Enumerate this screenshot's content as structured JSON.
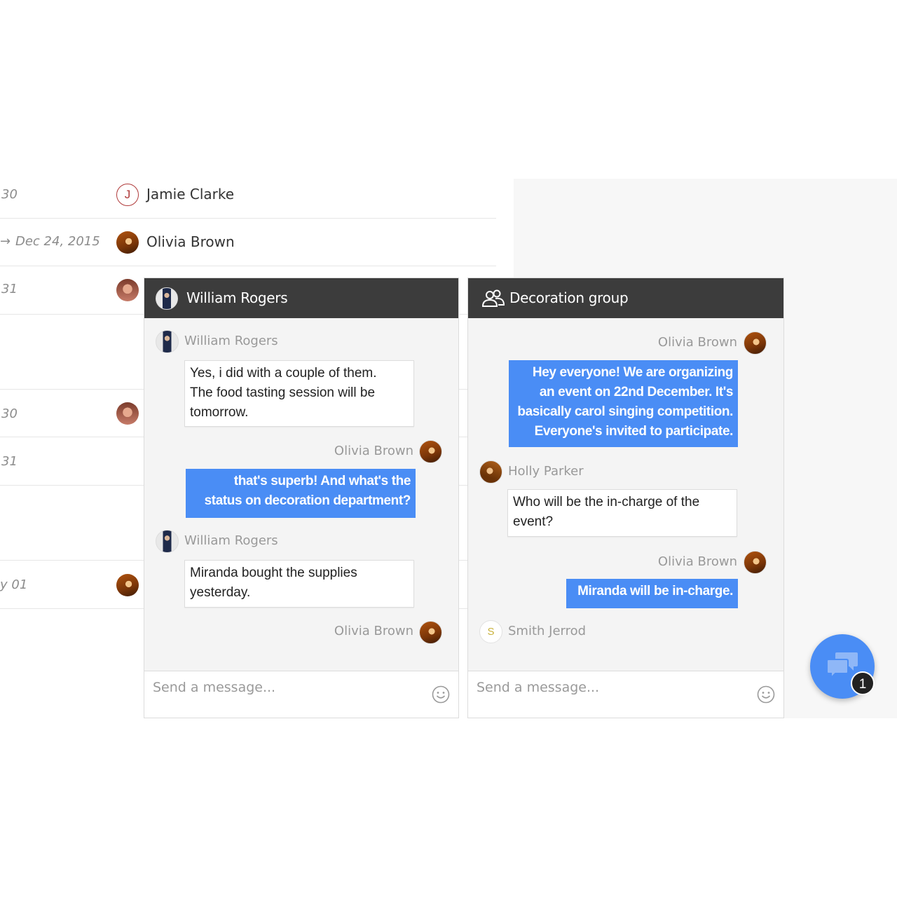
{
  "background_list": {
    "rows": [
      {
        "date": "30",
        "name": "Jamie Clarke",
        "initial": "J"
      },
      {
        "date": "Dec 24, 2015",
        "name": "Olivia Brown"
      },
      {
        "date": "31"
      },
      {
        "date": "30"
      },
      {
        "date": "31"
      },
      {
        "date": "y 01"
      }
    ]
  },
  "chat_william": {
    "title": "William Rogers",
    "messages": [
      {
        "sender": "William Rogers",
        "text_lines": [
          "Yes, i did with a couple of them.",
          "The food tasting session will be",
          "tomorrow."
        ]
      },
      {
        "sender": "Olivia Brown",
        "text_lines": [
          "that's superb! And what's the",
          "status on decoration department?"
        ]
      },
      {
        "sender": "William Rogers",
        "text_lines": [
          "Miranda bought the supplies",
          "yesterday."
        ]
      },
      {
        "sender": "Olivia Brown"
      }
    ],
    "composer_placeholder": "Send a message..."
  },
  "chat_group": {
    "title": "Decoration group",
    "messages": [
      {
        "sender": "Olivia Brown",
        "text_lines": [
          "Hey everyone! We are organizing",
          "an event on 22nd December. It's",
          "basically carol singing competition.",
          "Everyone's invited to participate."
        ]
      },
      {
        "sender": "Holly Parker",
        "text_lines": [
          "Who will be the in-charge of the",
          "event?"
        ]
      },
      {
        "sender": "Olivia Brown",
        "text_lines": [
          "Miranda will be in-charge."
        ]
      },
      {
        "sender": "Smith Jerrod",
        "initial": "S"
      }
    ],
    "composer_placeholder": "Send a message..."
  },
  "fab": {
    "icon": "chat-bubbles-icon",
    "badge": "1"
  },
  "colors": {
    "accent": "#4a8df5",
    "header": "#3c3c3c"
  }
}
